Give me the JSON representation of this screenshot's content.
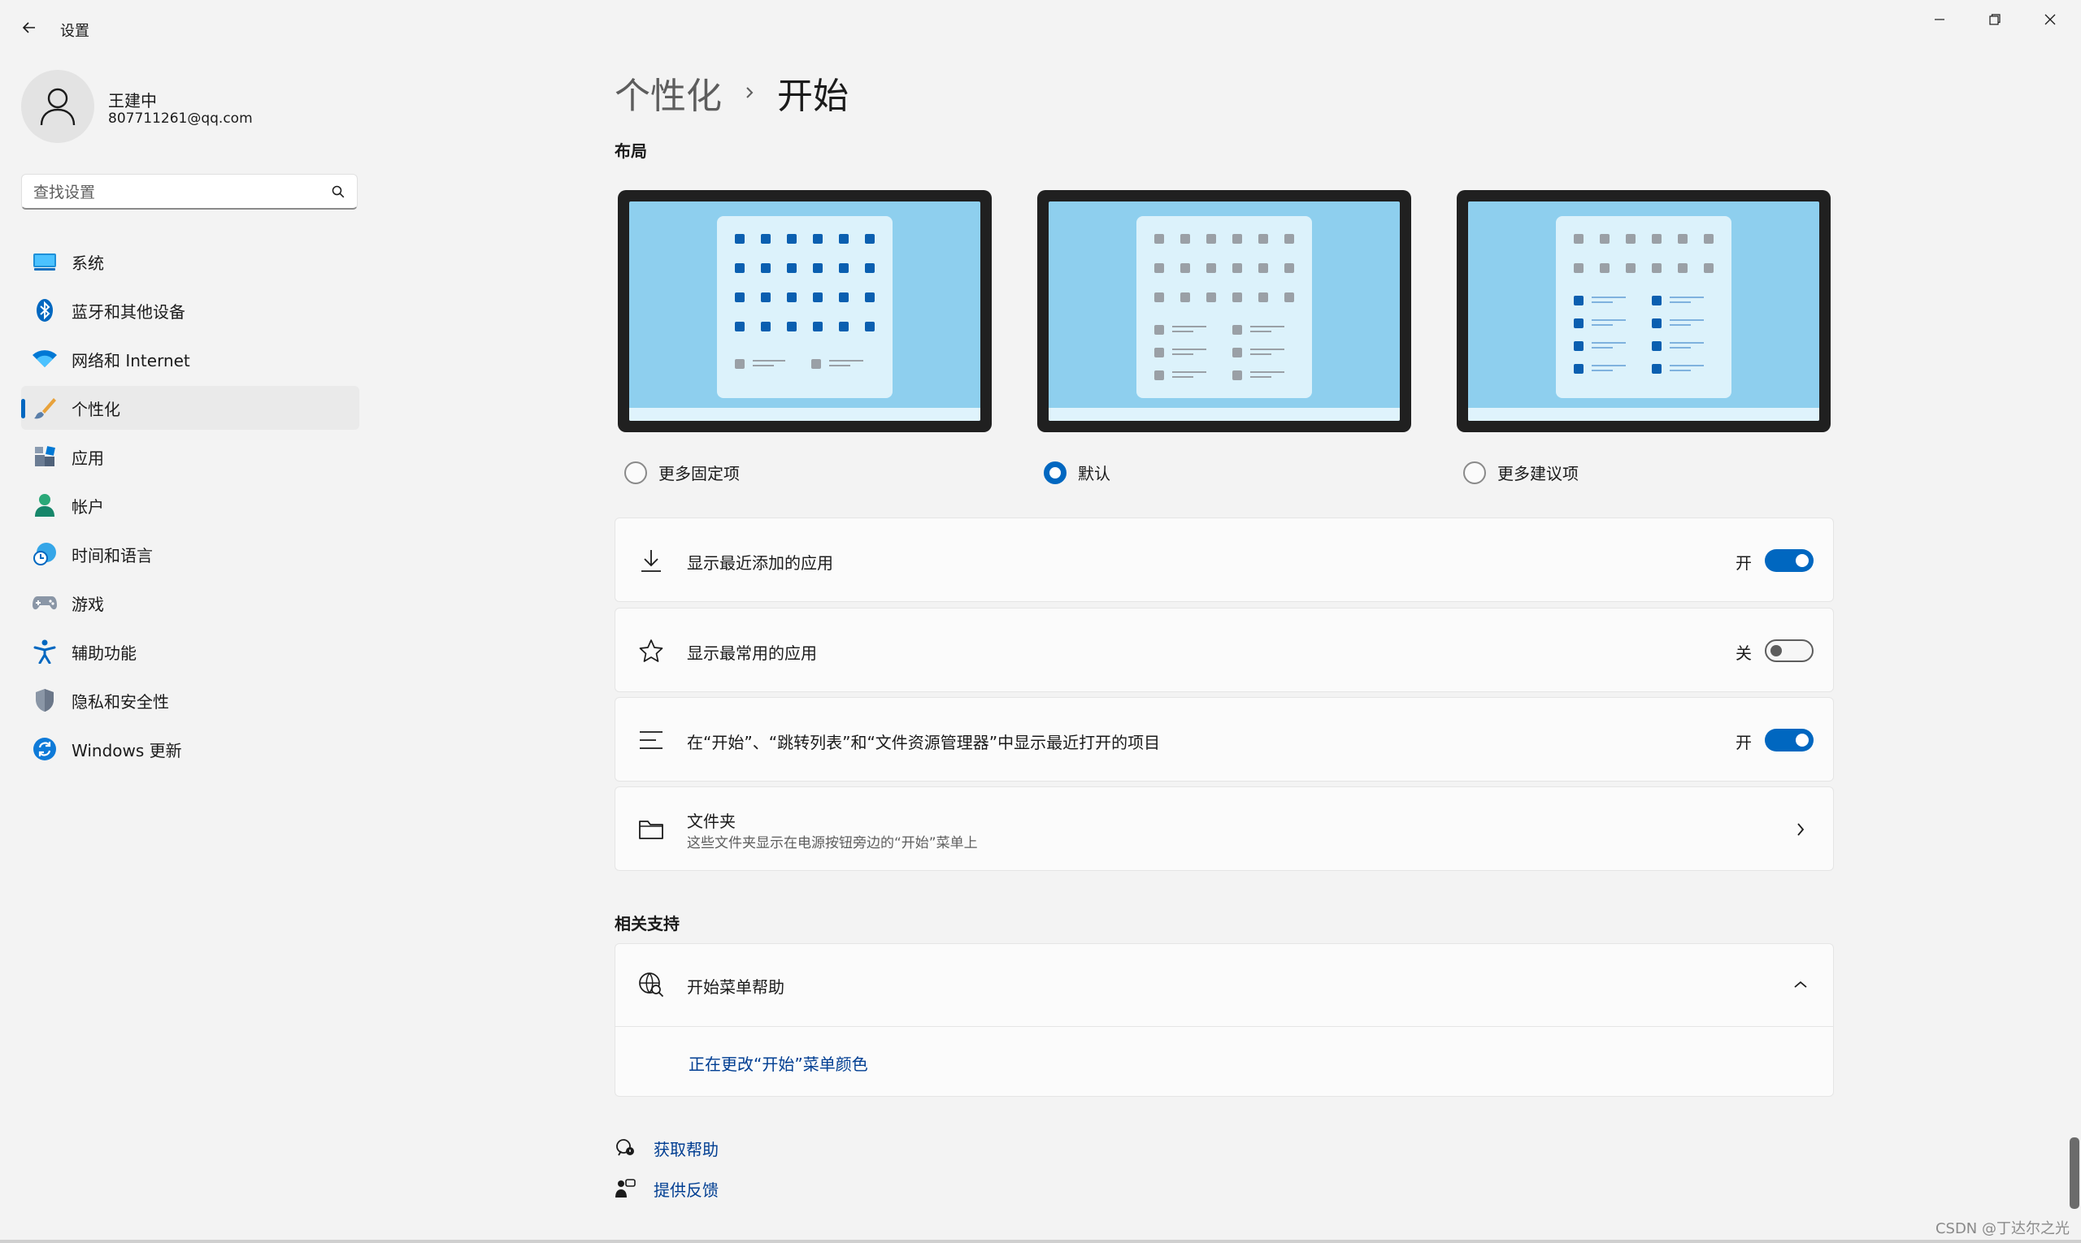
{
  "window": {
    "title": "设置",
    "back_icon": "back-arrow-icon",
    "controls": [
      "minimize-icon",
      "restore-icon",
      "close-icon"
    ]
  },
  "profile": {
    "name": "王建中",
    "email": "807711261@qq.com"
  },
  "search": {
    "placeholder": "查找设置"
  },
  "sidebar": {
    "items": [
      {
        "label": "系统",
        "icon": "monitor-icon",
        "selected": false
      },
      {
        "label": "蓝牙和其他设备",
        "icon": "bluetooth-icon",
        "selected": false
      },
      {
        "label": "网络和 Internet",
        "icon": "wifi-icon",
        "selected": false
      },
      {
        "label": "个性化",
        "icon": "paintbrush-icon",
        "selected": true
      },
      {
        "label": "应用",
        "icon": "apps-icon",
        "selected": false
      },
      {
        "label": "帐户",
        "icon": "person-icon",
        "selected": false
      },
      {
        "label": "时间和语言",
        "icon": "clock-globe-icon",
        "selected": false
      },
      {
        "label": "游戏",
        "icon": "gamepad-icon",
        "selected": false
      },
      {
        "label": "辅助功能",
        "icon": "accessibility-icon",
        "selected": false
      },
      {
        "label": "隐私和安全性",
        "icon": "shield-icon",
        "selected": false
      },
      {
        "label": "Windows 更新",
        "icon": "refresh-icon",
        "selected": false
      }
    ]
  },
  "breadcrumb": {
    "parent": "个性化",
    "current": "开始"
  },
  "layout": {
    "heading": "布局",
    "options": [
      {
        "label": "更多固定项",
        "selected": false
      },
      {
        "label": "默认",
        "selected": true
      },
      {
        "label": "更多建议项",
        "selected": false
      }
    ]
  },
  "settings": [
    {
      "label": "显示最近添加的应用",
      "icon": "download-icon",
      "state": "开",
      "on": true
    },
    {
      "label": "显示最常用的应用",
      "icon": "star-icon",
      "state": "关",
      "on": false
    },
    {
      "label": "在“开始”、“跳转列表”和“文件资源管理器”中显示最近打开的项目",
      "icon": "list-icon",
      "state": "开",
      "on": true
    }
  ],
  "folders": {
    "title": "文件夹",
    "subtitle": "这些文件夹显示在电源按钮旁边的“开始”菜单上",
    "icon": "folder-icon"
  },
  "support": {
    "heading": "相关支持",
    "help_title": "开始菜单帮助",
    "help_icon": "globe-search-icon",
    "link": "正在更改“开始”菜单颜色"
  },
  "footer": {
    "get_help": "获取帮助",
    "feedback": "提供反馈"
  },
  "colors": {
    "accent": "#0067c0",
    "background": "#f3f3f3",
    "card": "#fbfbfb",
    "preview_screen": "#8ecfee",
    "preview_frame": "#202020",
    "link": "#003e92"
  },
  "watermark": "CSDN @丁达尔之光"
}
